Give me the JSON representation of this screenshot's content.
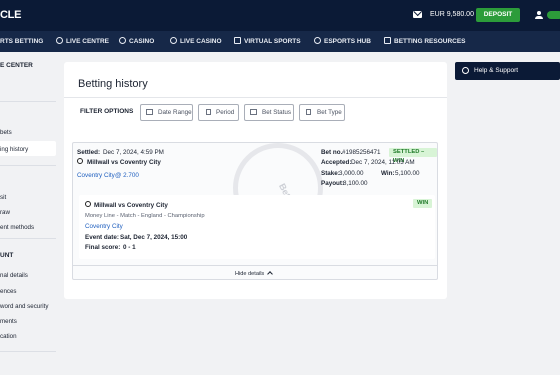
{
  "header": {
    "logo_text": "CLE",
    "balance": "EUR 9,580.00",
    "deposit_label": "DEPOSIT"
  },
  "nav": {
    "items": [
      {
        "label": "RTS BETTING",
        "icon": "none"
      },
      {
        "label": "LIVE CENTRE",
        "icon": "live-icon"
      },
      {
        "label": "CASINO",
        "icon": "casino-icon"
      },
      {
        "label": "LIVE CASINO",
        "icon": "live-casino-icon"
      },
      {
        "label": "VIRTUAL SPORTS",
        "icon": "virtual-sports-icon"
      },
      {
        "label": "ESPORTS HUB",
        "icon": "esports-icon"
      },
      {
        "label": "BETTING RESOURCES",
        "icon": "resources-icon"
      }
    ]
  },
  "sidebar": {
    "section_title": "E CENTER",
    "bets_item": "bets",
    "history_item": "ing history",
    "items2": [
      "sit",
      "raw",
      "ent methods"
    ],
    "account_title": "UNT",
    "items3": [
      "nal details",
      "ences",
      "word and security",
      "ments",
      "cation"
    ]
  },
  "page": {
    "title": "Betting history",
    "filter_label": "FILTER OPTIONS",
    "filters": [
      "Date Range",
      "Period",
      "Bet Status",
      "Bet Type"
    ]
  },
  "bet": {
    "settled_label": "Settled:",
    "settled_value": "Dec 7, 2024, 4:59 PM",
    "match": "Millwall vs Coventry City",
    "selection": "Coventry City",
    "odds": "@ 2.700",
    "bet_no_label": "Bet no.",
    "bet_no": "#1985256471",
    "status": "SETTLED – WIN",
    "accepted_label": "Accepted:",
    "accepted_value": "Dec 7, 2024, 11:03 AM",
    "stake_label": "Stake:",
    "stake_value": "3,000.00",
    "win_label": "Win:",
    "win_value": "5,100.00",
    "payout_label": "Payout:",
    "payout_value": "8,100.00",
    "watermark": "Betway",
    "leg": {
      "match": "Millwall vs Coventry City",
      "market": "Money Line - Match - England - Championship",
      "selection": "Coventry City",
      "event_date_label": "Event date:",
      "event_date": "Sat, Dec 7, 2024, 15:00",
      "final_score_label": "Final score:",
      "final_score": "0 - 1",
      "result": "WIN"
    },
    "hide_details": "Hide details"
  },
  "support": {
    "label": "Help & Support"
  }
}
